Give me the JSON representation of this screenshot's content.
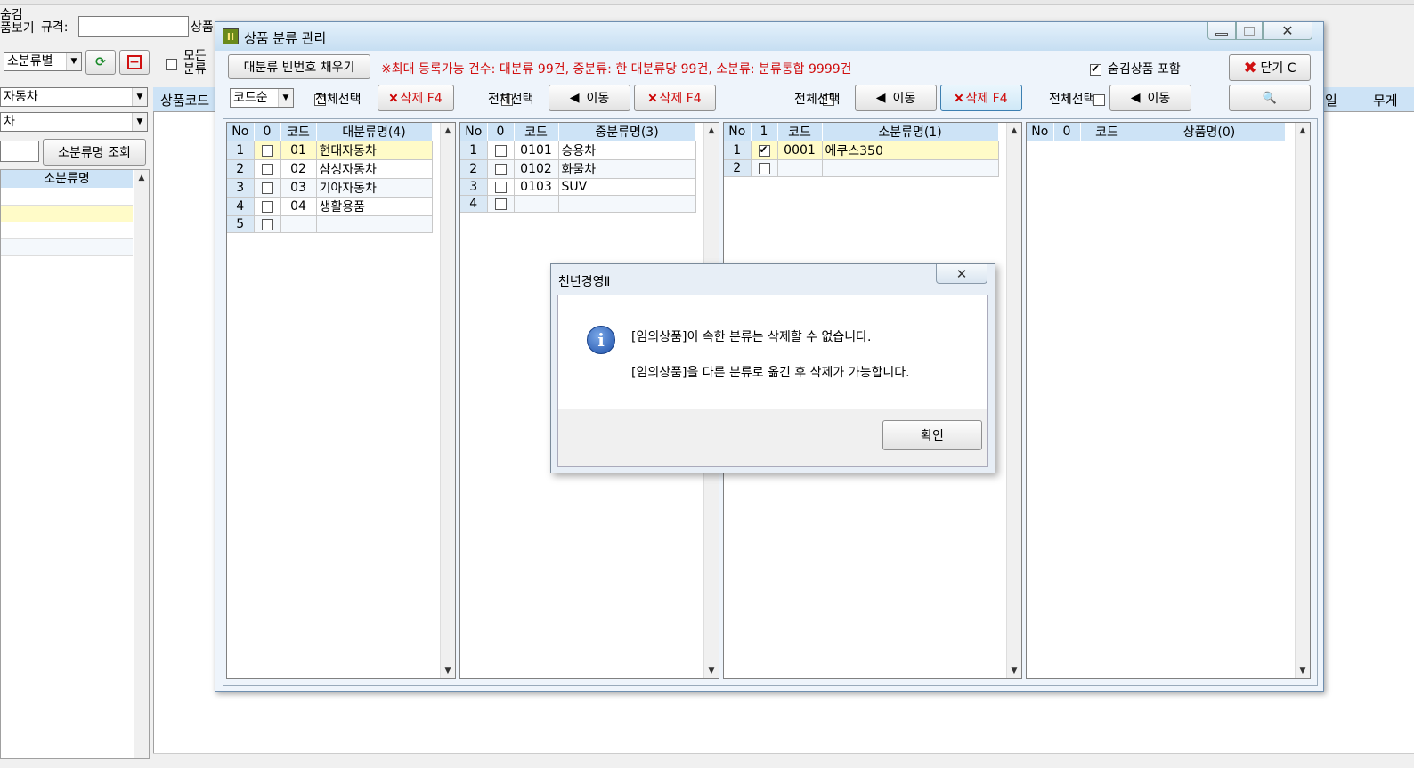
{
  "background": {
    "hidden_view_label": "숨김\n품보기",
    "spec_label": "규격:",
    "product_label": "상품",
    "sub_category_combo": "소분류별",
    "all_category_label": "모든\n분류",
    "combo1": "자동차",
    "combo2": "차",
    "sub_lookup_button": "소분류명 조회",
    "sub_list_header": "소분류명",
    "grid_header_left": "상품코드",
    "grid_header_right1": "일",
    "grid_header_right2": "무게"
  },
  "dialog": {
    "title": "상품 분류 관리",
    "fill_button": "대분류 빈번호 채우기",
    "notice": "※최대 등록가능 건수: 대분류 99건, 중분류: 한 대분류당 99건, 소분류: 분류통합 9999건",
    "include_hidden_label": "숨김상품 포함",
    "close_button": "닫기 C",
    "sort_combo": "코드순",
    "select_all": "전체선택",
    "delete_label": "삭제 F4",
    "move_label": "이동",
    "search_icon": "magnifier-icon"
  },
  "major": {
    "headers": [
      "No",
      "0",
      "코드",
      "대분류명(4)"
    ],
    "rows": [
      {
        "no": "1",
        "code": "01",
        "name": "현대자동차"
      },
      {
        "no": "2",
        "code": "02",
        "name": "삼성자동차"
      },
      {
        "no": "3",
        "code": "03",
        "name": "기아자동차"
      },
      {
        "no": "4",
        "code": "04",
        "name": "생활용품"
      },
      {
        "no": "5",
        "code": "",
        "name": ""
      }
    ]
  },
  "middle": {
    "headers": [
      "No",
      "0",
      "코드",
      "중분류명(3)"
    ],
    "rows": [
      {
        "no": "1",
        "code": "0101",
        "name": "승용차"
      },
      {
        "no": "2",
        "code": "0102",
        "name": "화물차"
      },
      {
        "no": "3",
        "code": "0103",
        "name": "SUV"
      },
      {
        "no": "4",
        "code": "",
        "name": ""
      }
    ]
  },
  "minor": {
    "headers": [
      "No",
      "1",
      "코드",
      "소분류명(1)"
    ],
    "rows": [
      {
        "no": "1",
        "code": "0001",
        "name": "에쿠스350"
      },
      {
        "no": "2",
        "code": "",
        "name": ""
      }
    ]
  },
  "products": {
    "headers": [
      "No",
      "0",
      "코드",
      "상품명(0)"
    ]
  },
  "alert": {
    "title": "천년경영Ⅱ",
    "line1": "[임의상품]이 속한 분류는 삭제할 수 없습니다.",
    "line2": "[임의상품]을 다른 분류로 옮긴 후 삭제가 가능합니다.",
    "ok_button": "확인"
  }
}
